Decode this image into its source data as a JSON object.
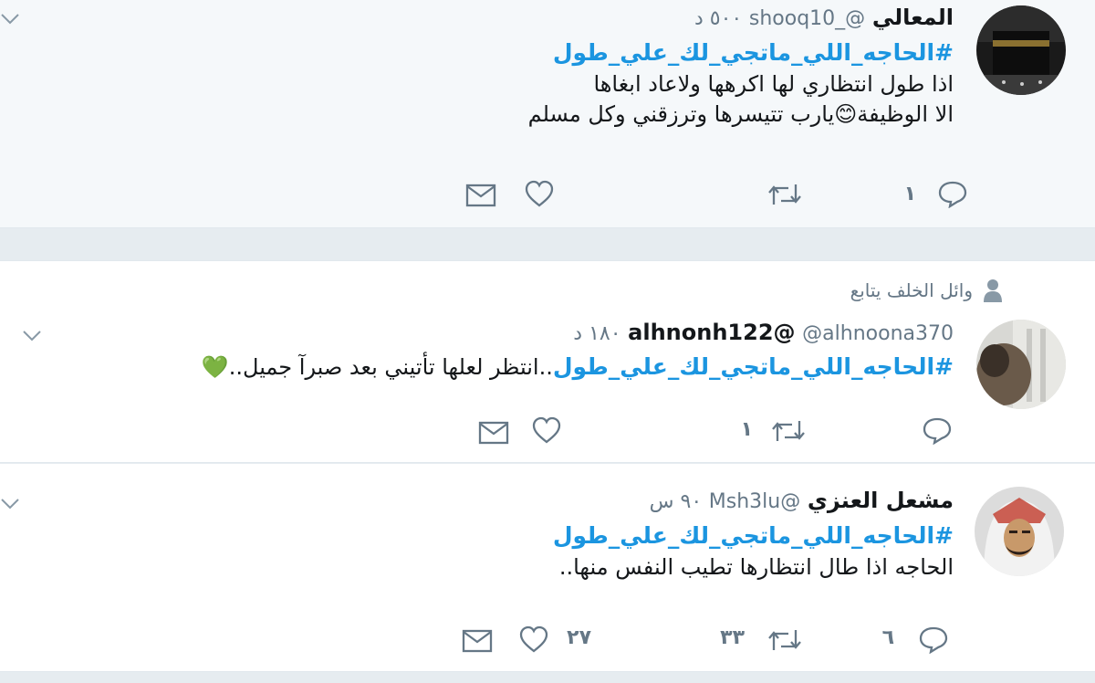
{
  "tweets": [
    {
      "name": "المعالي",
      "handle": "@_shooq10",
      "time": "٥٠٠ د",
      "hashtag": "#الحاجه_اللي_ماتجي_لك_علي_طول",
      "lines": [
        "اذا طول انتظاري لها اكرهها ولاعاد ابغاها",
        "الا الوظيفة😊يارب تتيسرها وترزقني وكل مسلم"
      ],
      "replies": "١",
      "retweets": "",
      "likes": ""
    },
    {
      "context": "وائل الخلف يتابع",
      "name": "alhnonh122@",
      "handle": "@alhnoona370",
      "time": "١٨٠ د",
      "hashtag": "#الحاجه_اللي_ماتجي_لك_علي_طول",
      "text_after": "..انتظر  لعلها تأتيني بعد صبرآ جميل..💚",
      "replies": "",
      "retweets": "١",
      "likes": ""
    },
    {
      "name": "مشعل العنزي",
      "handle": "@Msh3lu",
      "time": "٩٠ س",
      "hashtag": "#الحاجه_اللي_ماتجي_لك_علي_طول",
      "lines": [
        "الحاجه اذا طال انتظارها تطيب النفس منها.."
      ],
      "replies": "٦",
      "retweets": "٣٣",
      "likes": "٢٧"
    }
  ],
  "icons": {
    "reply": "reply-icon",
    "retweet": "retweet-icon",
    "like": "heart-icon",
    "dm": "envelope-icon",
    "caret": "chevron-down-icon",
    "follow": "person-icon"
  },
  "colors": {
    "hashtag": "#1b95e0",
    "text": "#14171a",
    "meta": "#657786",
    "background": "#e6ecf0"
  }
}
